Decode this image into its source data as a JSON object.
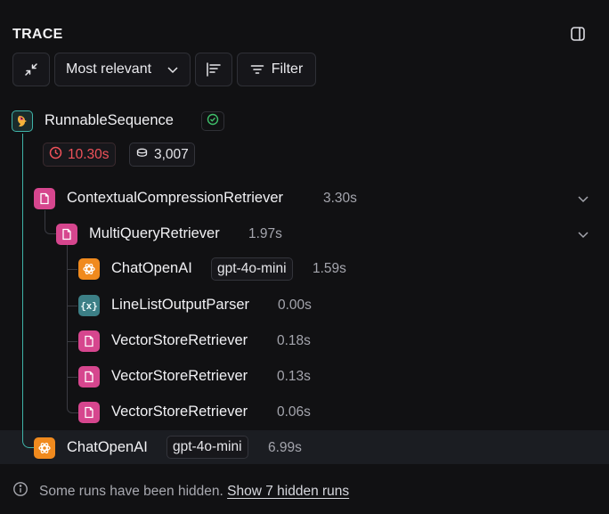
{
  "panel": {
    "title": "TRACE"
  },
  "toolbar": {
    "sort_label": "Most relevant",
    "filter_label": "Filter"
  },
  "root": {
    "name": "RunnableSequence",
    "status": "success",
    "latency": "10.30s",
    "tokens": "3,007"
  },
  "runs": [
    {
      "name": "ContextualCompressionRetriever",
      "duration": "3.30s",
      "icon": "document-icon"
    },
    {
      "name": "MultiQueryRetriever",
      "duration": "1.97s",
      "icon": "document-icon"
    },
    {
      "name": "ChatOpenAI",
      "model": "gpt-4o-mini",
      "duration": "1.59s",
      "icon": "openai-icon"
    },
    {
      "name": "LineListOutputParser",
      "duration": "0.00s",
      "icon": "parser-icon",
      "icon_text": "{x}"
    },
    {
      "name": "VectorStoreRetriever",
      "duration": "0.18s",
      "icon": "document-icon"
    },
    {
      "name": "VectorStoreRetriever",
      "duration": "0.13s",
      "icon": "document-icon"
    },
    {
      "name": "VectorStoreRetriever",
      "duration": "0.06s",
      "icon": "document-icon"
    },
    {
      "name": "ChatOpenAI",
      "model": "gpt-4o-mini",
      "duration": "6.99s",
      "icon": "openai-icon"
    }
  ],
  "footer": {
    "message": "Some runs have been hidden.",
    "link": "Show 7 hidden runs"
  },
  "colors": {
    "accent_teal": "#3fb3a8",
    "error_red": "#f0525a",
    "doc_pink": "#d6468e",
    "openai_orange": "#f08a1e"
  }
}
